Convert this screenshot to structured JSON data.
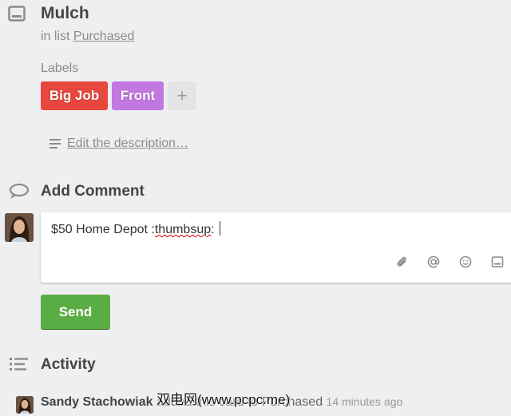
{
  "card": {
    "title": "Mulch",
    "in_list_prefix": "in list",
    "list_name": "Purchased"
  },
  "labels": {
    "heading": "Labels",
    "items": [
      {
        "text": "Big Job",
        "color": "#e8473d"
      },
      {
        "text": "Front",
        "color": "#c377e0"
      }
    ],
    "add_symbol": "+"
  },
  "description": {
    "edit_link": "Edit the description…"
  },
  "add_comment": {
    "title": "Add Comment",
    "value_prefix": "$50 Home Depot :",
    "value_misspelled": "thumbsup",
    "value_suffix": ": ",
    "toolbar_icons": [
      "paperclip-icon",
      "at-mention-icon",
      "emoji-icon",
      "card-icon"
    ]
  },
  "send": {
    "label": "Send",
    "color": "#5aac44"
  },
  "activity": {
    "title": "Activity",
    "entries": [
      {
        "user": "Sandy Stachowiak",
        "action": "added this card to Purchased",
        "time": "14 minutes ago"
      }
    ]
  },
  "watermark": {
    "text": "双电网(www.pcpc.me)"
  }
}
